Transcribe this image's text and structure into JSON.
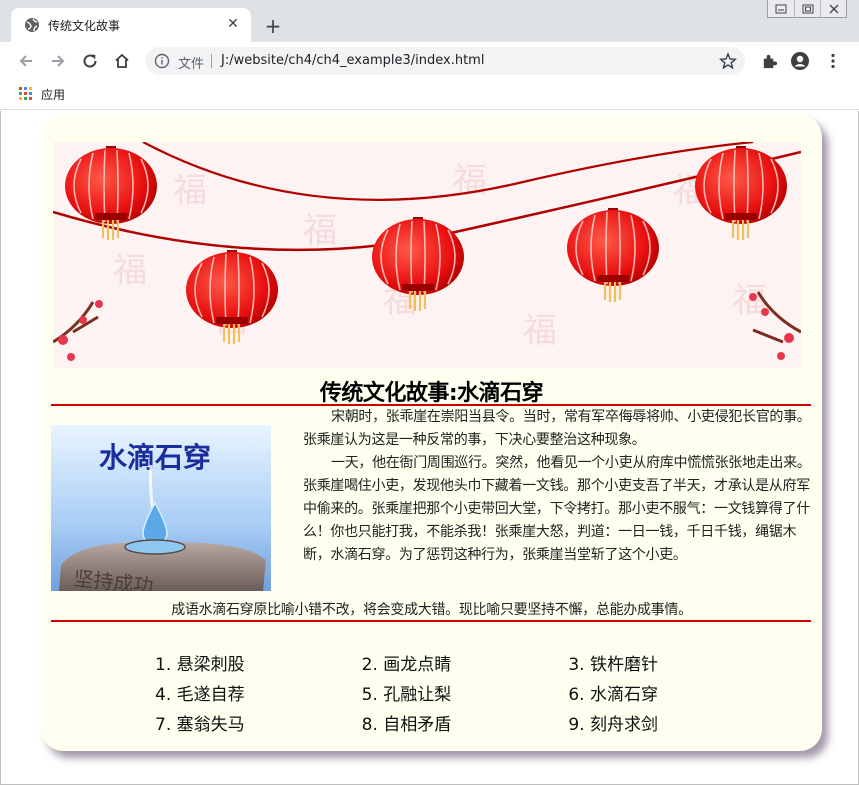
{
  "browser": {
    "tab_title": "传统文化故事",
    "close_symbol": "✕",
    "new_tab_symbol": "+",
    "omnibox_label": "文件",
    "url": "J:/website/ch4/ch4_example3/index.html",
    "bookmarks_apps_label": "应用"
  },
  "page": {
    "title": "传统文化故事:水滴石穿",
    "image_caption": "水滴石穿",
    "image_engraving": "坚持成功",
    "story_paragraphs": [
      "宋朝时，张乖崖在崇阳当县令。当时，常有军卒侮辱将帅、小吏侵犯长官的事。张乘崖认为这是一种反常的事，下决心要整治这种现象。",
      "一天，他在衙门周围巡行。突然，他看见一个小吏从府库中慌慌张张地走出来。张乘崖喝住小吏，发现他头巾下藏着一文钱。那个小吏支吾了半天，才承认是从府军中偷来的。张乘崖把那个小吏带回大堂，下令拷打。那小吏不服气：一文钱算得了什么！你也只能打我，不能杀我！张乘崖大怒，判道：一日一钱，千日千钱，绳锯木断，水滴石穿。为了惩罚这种行为，张乘崖当堂斩了这个小吏。"
    ],
    "conclusion": "成语水滴石穿原比喻小错不改，将会变成大错。现比喻只要坚持不懈，总能办成事情。",
    "idioms": [
      [
        "1. 悬梁刺股",
        "2. 画龙点睛",
        "3. 铁杵磨针"
      ],
      [
        "4. 毛遂自荐",
        "5. 孔融让梨",
        "6. 水滴石穿"
      ],
      [
        "7. 塞翁失马",
        "8. 自相矛盾",
        "9. 刻舟求剑"
      ]
    ]
  },
  "colors": {
    "card_bg": "#fffff0",
    "rule_red": "#cc0000",
    "lantern_red": "#ee1111",
    "lantern_gold": "#f0c060"
  },
  "icons": [
    "globe-icon",
    "close-icon",
    "plus-icon",
    "back-arrow-icon",
    "forward-arrow-icon",
    "reload-icon",
    "home-icon",
    "info-icon",
    "star-icon",
    "extensions-icon",
    "account-icon",
    "menu-icon",
    "apps-grid-icon"
  ]
}
